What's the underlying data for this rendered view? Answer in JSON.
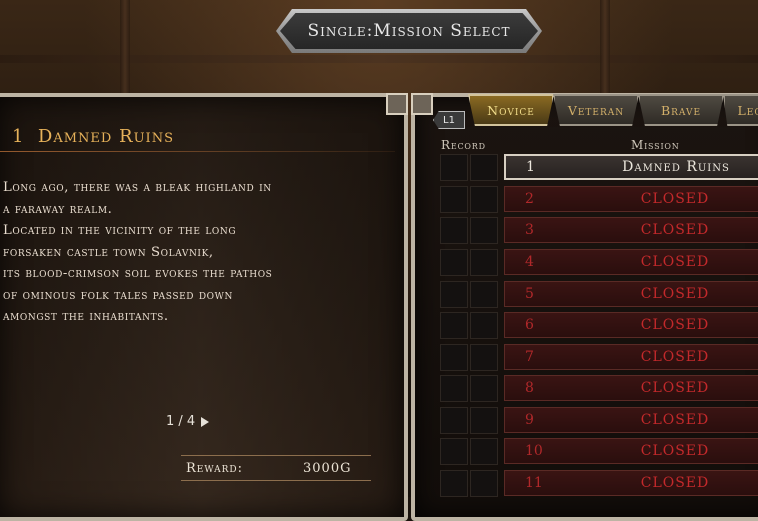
{
  "title": "Single:Mission Select",
  "detail": {
    "number": "1",
    "name": "Damned Ruins",
    "description_lines": [
      "Long ago, there was a bleak highland in",
      "a faraway realm.",
      "Located in the vicinity of the long",
      "forsaken castle town Solavnik,",
      "its blood-crimson soil evokes the pathos",
      "of ominous folk tales passed down",
      "amongst the inhabitants."
    ],
    "page": "1 / 4",
    "reward_label": "Reward:",
    "reward_value": "3000G"
  },
  "tabs": {
    "prev_button": "L1",
    "items": [
      {
        "label": "Novice"
      },
      {
        "label": "Veteran"
      },
      {
        "label": "Brave"
      },
      {
        "label": "Leg"
      }
    ]
  },
  "list": {
    "record_header": "Record",
    "mission_header": "Mission",
    "rows": [
      {
        "num": "1",
        "name": "Damned Ruins"
      },
      {
        "num": "2",
        "name": "CLOSED"
      },
      {
        "num": "3",
        "name": "CLOSED"
      },
      {
        "num": "4",
        "name": "CLOSED"
      },
      {
        "num": "5",
        "name": "CLOSED"
      },
      {
        "num": "6",
        "name": "CLOSED"
      },
      {
        "num": "7",
        "name": "CLOSED"
      },
      {
        "num": "8",
        "name": "CLOSED"
      },
      {
        "num": "9",
        "name": "CLOSED"
      },
      {
        "num": "10",
        "name": "CLOSED"
      },
      {
        "num": "11",
        "name": "CLOSED"
      }
    ]
  },
  "colors": {
    "heading": "#e7b25a",
    "closed_text": "#c3292b",
    "selected_row": "#ece7dd",
    "active_tab": "#f1dc8a"
  }
}
